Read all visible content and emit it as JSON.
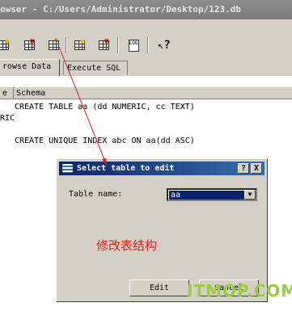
{
  "window": {
    "title": "owser - C:/Users/Administrator/Desktop/123.db"
  },
  "toolbar": {
    "icons": [
      "create-table-icon",
      "delete-table-icon",
      "modify-table-icon",
      "create-index-icon",
      "delete-index-icon",
      "log-icon",
      "whats-this-icon"
    ],
    "log_label": "LOG",
    "help_label": "?"
  },
  "tabs": [
    {
      "label": "rowse Data"
    },
    {
      "label": "Execute SQL"
    }
  ],
  "grid": {
    "columns": [
      "e",
      "Schema"
    ],
    "rows": [
      {
        "name": "",
        "schema": "CREATE TABLE aa (dd NUMERIC, cc TEXT)"
      },
      {
        "name": "RIC",
        "schema": ""
      },
      {
        "name": "",
        "schema": "CREATE UNIQUE INDEX abc ON aa(dd ASC)"
      }
    ]
  },
  "dialog": {
    "title": "Select table to edit",
    "help_btn": "?",
    "close_btn": "X",
    "field_label": "Table name:",
    "selected_table": "aa",
    "edit_label": "Edit",
    "cancel_label": "Cancel"
  },
  "annotation": {
    "text": "修改表结构",
    "color": "#e0201a"
  },
  "watermark": {
    "text": "ITMOP.COM"
  }
}
